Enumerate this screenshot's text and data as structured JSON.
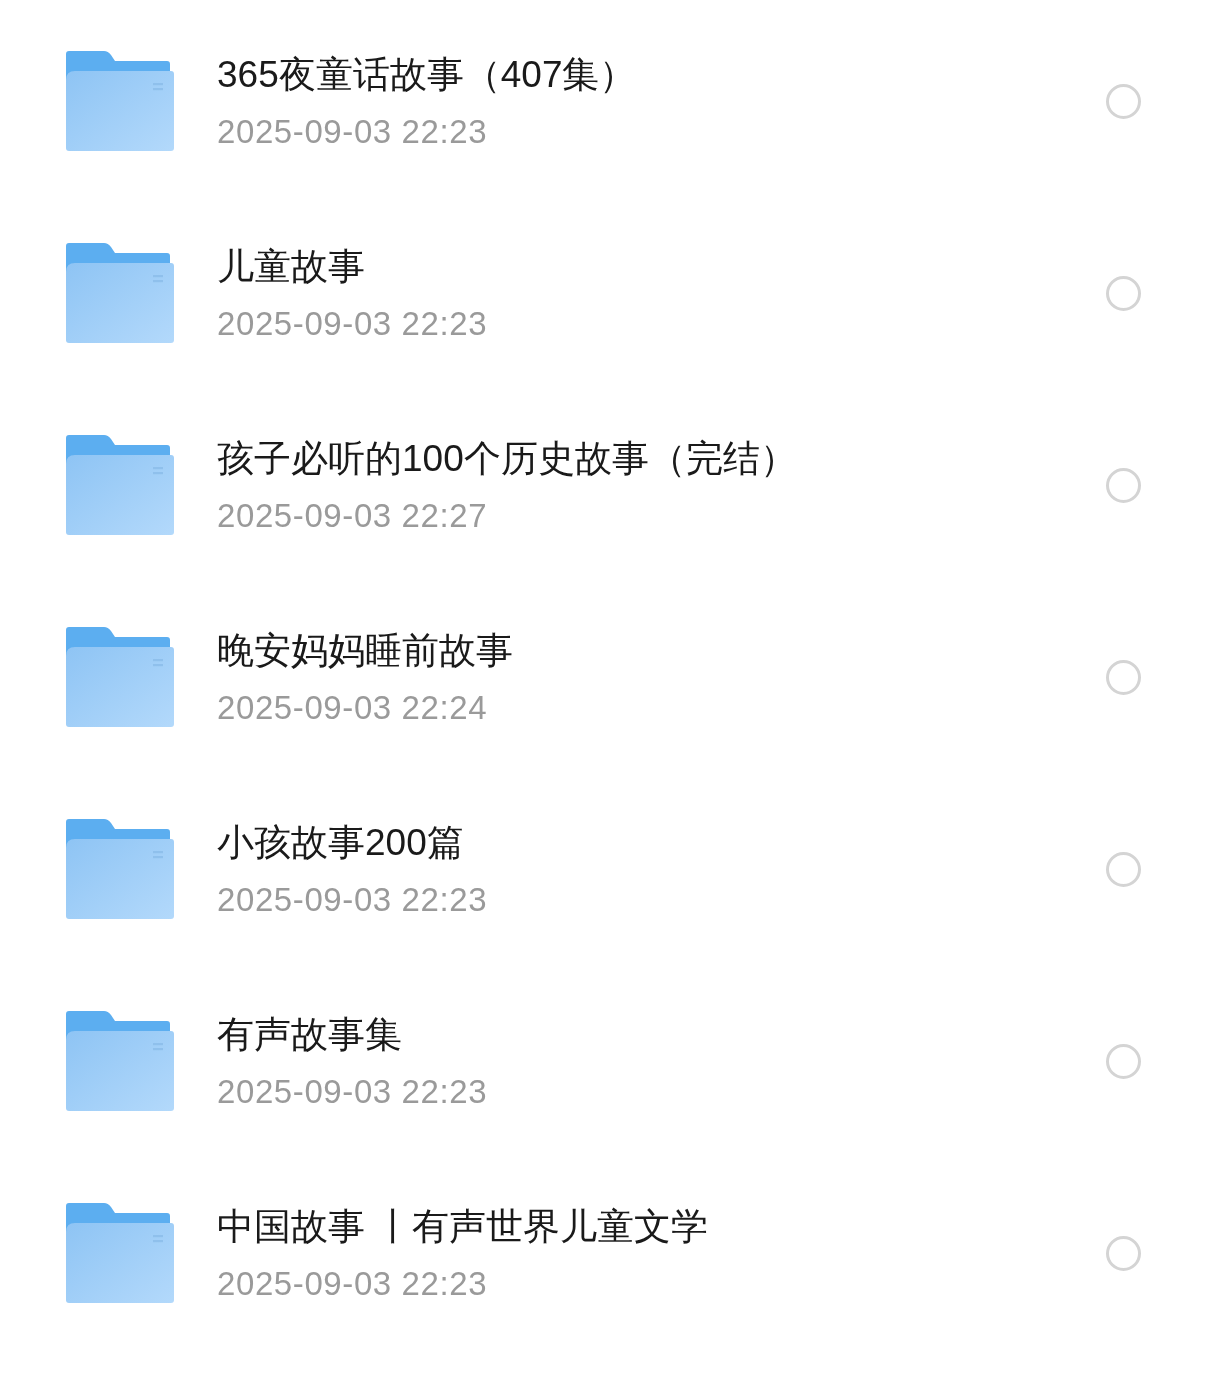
{
  "folders": [
    {
      "name": "365夜童话故事（407集）",
      "modified": "2025-09-03 22:23",
      "selected": false
    },
    {
      "name": "儿童故事",
      "modified": "2025-09-03 22:23",
      "selected": false
    },
    {
      "name": "孩子必听的100个历史故事（完结）",
      "modified": "2025-09-03 22:27",
      "selected": false
    },
    {
      "name": "晚安妈妈睡前故事",
      "modified": "2025-09-03 22:24",
      "selected": false
    },
    {
      "name": "小孩故事200篇",
      "modified": "2025-09-03 22:23",
      "selected": false
    },
    {
      "name": "有声故事集",
      "modified": "2025-09-03 22:23",
      "selected": false
    },
    {
      "name": "中国故事 丨有声世界儿童文学",
      "modified": "2025-09-03 22:23",
      "selected": false
    }
  ]
}
